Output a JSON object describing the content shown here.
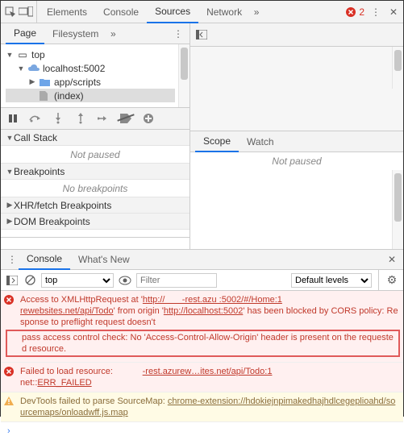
{
  "topbar": {
    "tabs": [
      "Elements",
      "Console",
      "Sources",
      "Network"
    ],
    "active": 2,
    "error_count": "2"
  },
  "subbar": {
    "tabs": [
      "Page",
      "Filesystem"
    ],
    "active": 0
  },
  "tree": {
    "root": "top",
    "host": "localhost:5002",
    "folder": "app/scripts",
    "file": "(index)"
  },
  "scope_tabs": {
    "tabs": [
      "Scope",
      "Watch"
    ],
    "active": 0,
    "not_paused": "Not paused"
  },
  "sections": {
    "callstack": {
      "label": "Call Stack",
      "body": "Not paused"
    },
    "breakpoints": {
      "label": "Breakpoints",
      "body": "No breakpoints"
    },
    "xhr": {
      "label": "XHR/fetch Breakpoints"
    },
    "dom": {
      "label": "DOM Breakpoints"
    }
  },
  "drawer": {
    "tabs": [
      "Console",
      "What's New"
    ],
    "active": 0
  },
  "console_toolbar": {
    "context": "top",
    "filter_placeholder": "Filter",
    "levels": "Default levels"
  },
  "messages": {
    "m1a": "Access to XMLHttpRequest at '",
    "m1b": "http://       -rest.azu :5002/#/Home:1",
    "m1c": "rewebsites.net/api/Todo",
    "m1d": "' from origin '",
    "m1e": "http://localhost:5002",
    "m1f": "' has been blocked by CORS policy: Response to preflight request doesn't ",
    "m1g": "pass access control check: No 'Access-Control-Allow-Origin' header is present on the requested resource.",
    "m2a": "Failed to load resource:            ",
    "m2b": "-rest.azurew…ites.net/api/Todo:1",
    "m2c": "net::",
    "m2d": "ERR_FAILED",
    "m3a": "DevTools failed to parse SourceMap: ",
    "m3b": "chrome-extension://hdokiejnpimakedhajhdlcegeplioahd/sourcemaps/onloadwff.js.map"
  }
}
